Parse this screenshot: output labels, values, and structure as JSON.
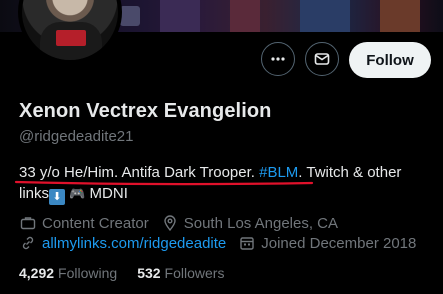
{
  "profile": {
    "display_name": "Xenon Vectrex Evangelion",
    "handle": "@ridgedeadite21",
    "bio": {
      "part1": "33 y/o He/Him. Antifa Dark Trooper. ",
      "hashtag": "#BLM",
      "part2": ". Twitch & other",
      "part3_before": "links",
      "part3_after": " MDNI"
    },
    "category": "Content Creator",
    "location": "South Los Angeles, CA",
    "link": "allmylinks.com/ridgedeadite",
    "joined": "Joined December 2018",
    "following_count": "4,292",
    "following_label": "Following",
    "followers_count": "532",
    "followers_label": "Followers"
  },
  "actions": {
    "follow_label": "Follow"
  },
  "colors": {
    "accent": "#1d9bf0",
    "underline": "#e0112b"
  }
}
